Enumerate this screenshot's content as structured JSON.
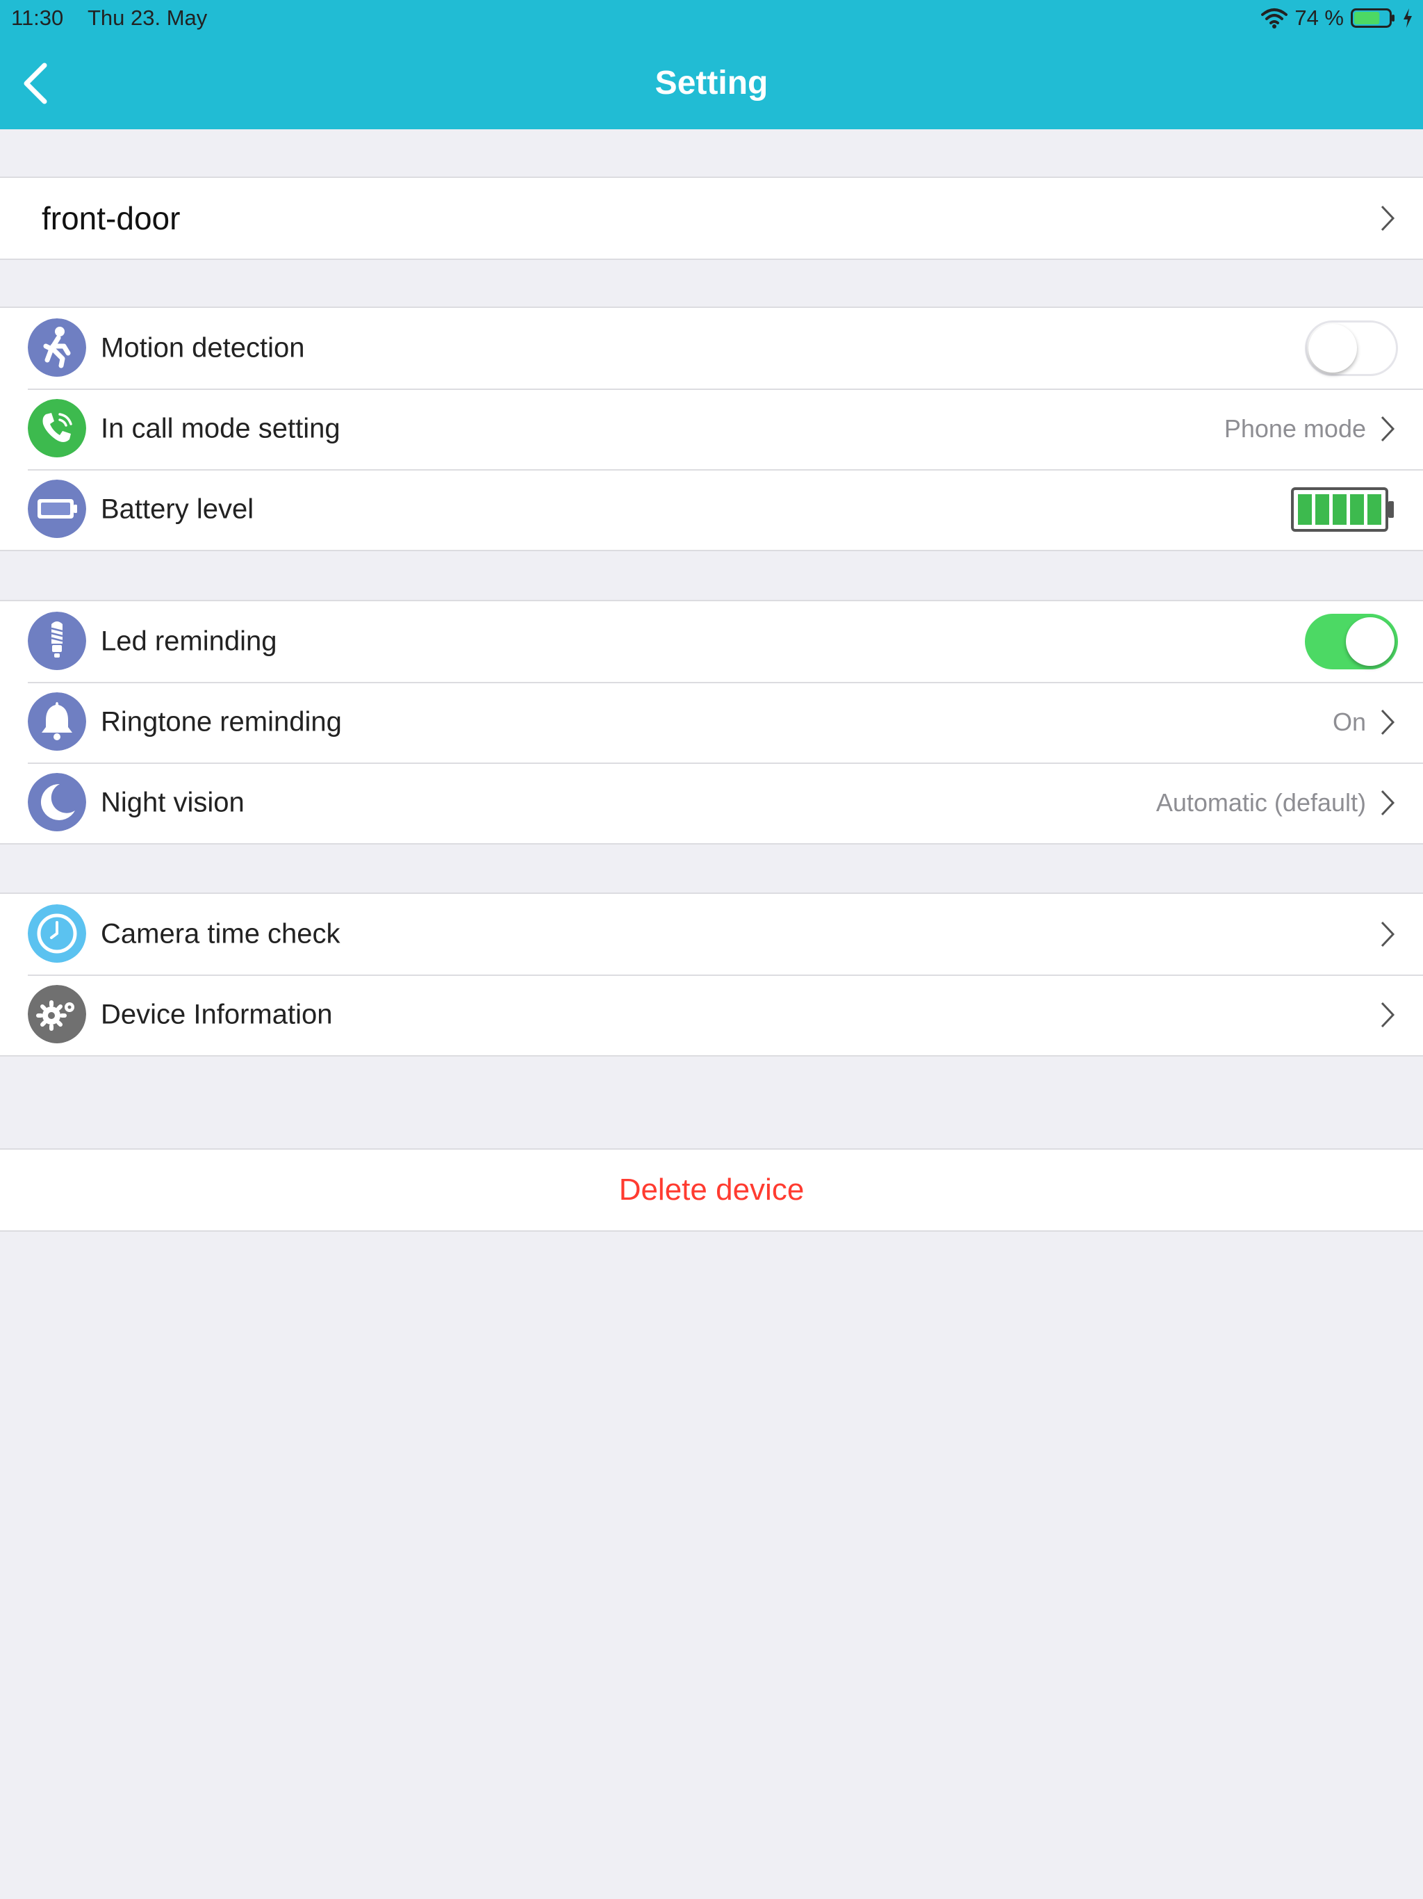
{
  "status_bar": {
    "time": "11:30",
    "date": "Thu 23. May",
    "battery_percent": "74 %",
    "battery_level": 0.74
  },
  "nav": {
    "title": "Setting"
  },
  "device": {
    "name": "front-door"
  },
  "group1": {
    "motion": {
      "label": "Motion detection",
      "enabled": false
    },
    "call_mode": {
      "label": "In call mode setting",
      "value": "Phone mode"
    },
    "battery": {
      "label": "Battery level",
      "level": 1.0
    }
  },
  "group2": {
    "led": {
      "label": "Led reminding",
      "enabled": true
    },
    "ringtone": {
      "label": "Ringtone reminding",
      "value": "On"
    },
    "night": {
      "label": "Night vision",
      "value": "Automatic (default)"
    }
  },
  "group3": {
    "time_check": {
      "label": "Camera time check"
    },
    "device_info": {
      "label": "Device Information"
    }
  },
  "actions": {
    "delete_label": "Delete device"
  },
  "colors": {
    "header": "#21bcd4",
    "toggle_on": "#4cd964",
    "danger": "#ff3b30",
    "icon_purple": "#6f7fc2",
    "icon_green": "#3dba4e",
    "icon_light_blue": "#5bc2f0",
    "icon_gray": "#707070"
  }
}
